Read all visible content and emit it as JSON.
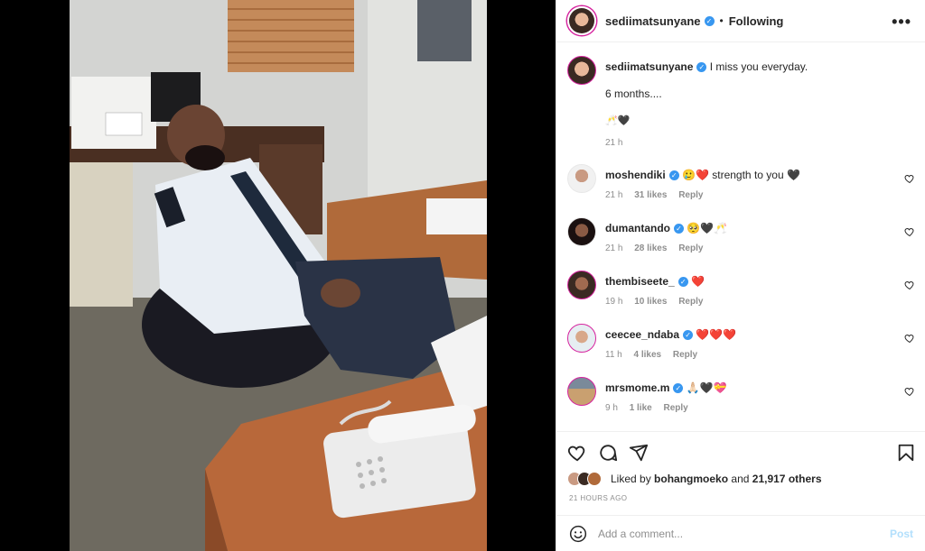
{
  "post": {
    "author": "sediimatsunyane",
    "follow_status": "Following",
    "dot": "•",
    "more": "•••",
    "caption_lines": [
      "I miss you everyday.",
      "6 months....",
      "🥂🖤"
    ],
    "caption_time": "21 h"
  },
  "comments": [
    {
      "user": "moshendiki",
      "text": "🥲❤️ strength to you 🖤",
      "time": "21 h",
      "likes": "31 likes",
      "reply": "Reply"
    },
    {
      "user": "dumantando",
      "text": "🥺🖤🥂",
      "time": "21 h",
      "likes": "28 likes",
      "reply": "Reply"
    },
    {
      "user": "thembiseete_",
      "text": "❤️",
      "time": "19 h",
      "likes": "10 likes",
      "reply": "Reply"
    },
    {
      "user": "ceecee_ndaba",
      "text": "❤️❤️❤️",
      "time": "11 h",
      "likes": "4 likes",
      "reply": "Reply"
    },
    {
      "user": "mrsmome.m",
      "text": "🙏🏻🖤💝",
      "time": "9 h",
      "likes": "1 like",
      "reply": "Reply"
    }
  ],
  "likes": {
    "prefix": "Liked by",
    "user": "bohangmoeko",
    "and": "and",
    "others": "21,917 others"
  },
  "timestamp": "21 HOURS AGO",
  "add_comment": {
    "placeholder": "Add a comment...",
    "post_label": "Post"
  },
  "colors": {
    "verified": "#3897f0",
    "muted": "#8e8e8e",
    "post_disabled": "#b2dffc"
  },
  "icons": [
    "heart-icon",
    "comment-icon",
    "share-icon",
    "bookmark-icon",
    "emoji-icon",
    "more-icon",
    "verified-icon"
  ]
}
